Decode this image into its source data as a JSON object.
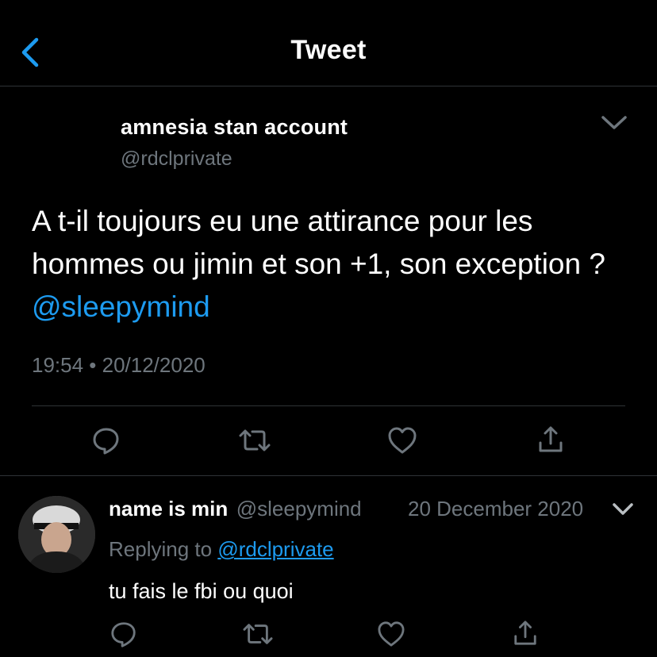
{
  "header": {
    "title": "Tweet"
  },
  "main_tweet": {
    "author_name": "amnesia stan account",
    "author_handle": "@rdclprivate",
    "text_plain": "A t-il toujours eu une attirance pour les hommes ou jimin et son +1, son exception ?",
    "text_mention": "@sleepymind",
    "meta": "19:54 • 20/12/2020"
  },
  "reply": {
    "author_name": "name is min",
    "author_handle": "@sleepymind",
    "date": "20 December 2020",
    "replying_label": "Replying to",
    "replying_handle": "@rdclprivate",
    "text": "tu fais le fbi ou quoi"
  },
  "colors": {
    "accent": "#1d9bf0",
    "muted": "#6e767d",
    "divider": "#2f3336",
    "background": "#000000"
  },
  "icons": [
    "back-chevron-icon",
    "chevron-down-icon",
    "reply-icon",
    "retweet-icon",
    "like-icon",
    "share-icon"
  ]
}
